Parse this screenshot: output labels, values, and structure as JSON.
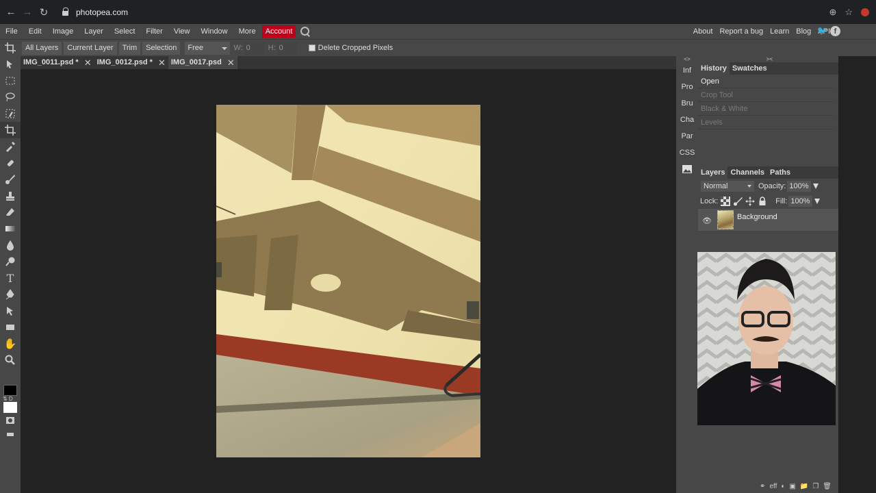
{
  "browser": {
    "url": "photopea.com"
  },
  "menu": {
    "items": [
      "File",
      "Edit",
      "Image",
      "Layer",
      "Select",
      "Filter",
      "View",
      "Window",
      "More"
    ],
    "account": "Account",
    "right_links": [
      "About",
      "Report a bug",
      "Learn",
      "Blog",
      "API"
    ]
  },
  "options": {
    "all_layers": "All Layers",
    "current_layer": "Current Layer",
    "trim": "Trim",
    "selection": "Selection",
    "ratio_mode": "Free",
    "w_label": "W:",
    "w_value": "0",
    "h_label": "H:",
    "h_value": "0",
    "delete_cropped": "Delete Cropped Pixels"
  },
  "doc_tabs": [
    {
      "name": "IMG_0011.psd *",
      "active": false
    },
    {
      "name": "IMG_0012.psd *",
      "active": false
    },
    {
      "name": "IMG_0017.psd",
      "active": true
    }
  ],
  "side_col": {
    "head": "<>",
    "items": [
      "Inf",
      "Pro",
      "Bru",
      "Cha",
      "Par",
      "CSS"
    ]
  },
  "panels": {
    "head": "><",
    "history_tab": "History",
    "swatches_tab": "Swatches",
    "history_items": [
      {
        "label": "Open",
        "state": "current"
      },
      {
        "label": "Crop Tool",
        "state": "future"
      },
      {
        "label": "Black & White",
        "state": "future"
      },
      {
        "label": "Levels",
        "state": "future"
      }
    ],
    "layers_tab": "Layers",
    "channels_tab": "Channels",
    "paths_tab": "Paths",
    "blend_mode": "Normal",
    "opacity_label": "Opacity:",
    "opacity_value": "100%",
    "lock_label": "Lock:",
    "fill_label": "Fill:",
    "fill_value": "100%",
    "layer_name": "Background",
    "bottom_eff": "eff"
  },
  "colors": {
    "account_bg": "#c0001a",
    "panel_bg": "#474747",
    "canvas_bg": "#222222"
  }
}
